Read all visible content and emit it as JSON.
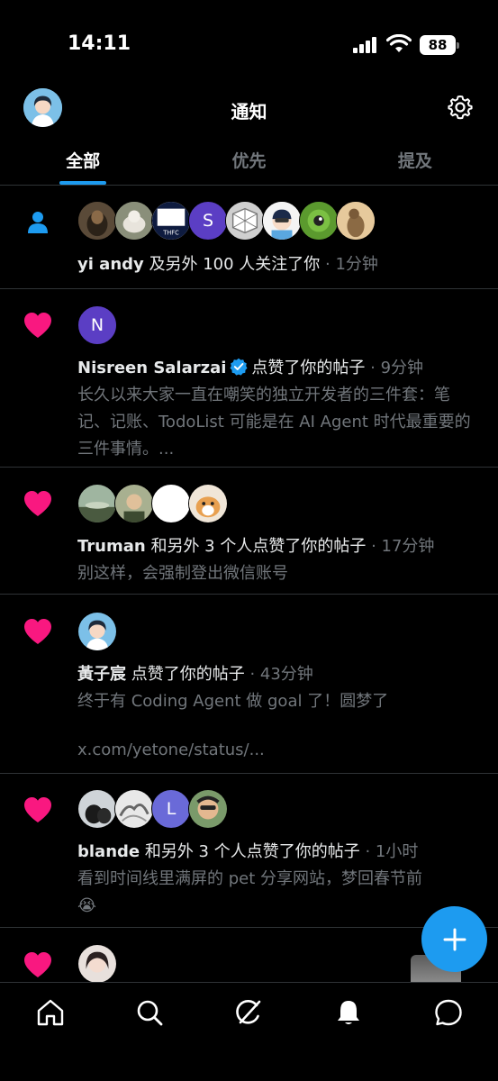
{
  "status_bar": {
    "time": "14:11",
    "battery": "88"
  },
  "header": {
    "title": "通知"
  },
  "tabs": [
    {
      "label": "全部"
    },
    {
      "label": "优先"
    },
    {
      "label": "提及"
    }
  ],
  "notifications": [
    {
      "type": "follow",
      "name": "yi andy",
      "action": " 及另外 100 人关注了你",
      "time": " · 1分钟",
      "avatar_letters": [
        "S"
      ]
    },
    {
      "type": "like",
      "name": "Nisreen Salarzai",
      "verified": true,
      "action": "点赞了你的帖子",
      "time": " · 9分钟",
      "avatar_letters": [
        "N"
      ],
      "body": "长久以来大家一直在嘲笑的独立开发者的三件套：笔记、记账、TodoList 可能是在 AI Agent 时代最重要的三件事情。..."
    },
    {
      "type": "like",
      "name": "Truman",
      "action": " 和另外 3 个人点赞了你的帖子",
      "time": " · 17分钟",
      "body": "别这样，会强制登出微信账号"
    },
    {
      "type": "like",
      "name": "黃子宸",
      "action": " 点赞了你的帖子",
      "time": " · 43分钟",
      "body": "终于有 Coding Agent 做 goal 了！圆梦了",
      "link": "x.com/yetone/status/..."
    },
    {
      "type": "like",
      "name": "blande",
      "action": " 和另外 3 个人点赞了你的帖子",
      "time": " · 1小时",
      "avatar_letters": [
        "L"
      ],
      "body": "看到时间线里满屏的 pet 分享网站，梦回春节前",
      "emoji": "😭"
    },
    {
      "type": "like"
    }
  ],
  "icons": {
    "settings": "gear-icon",
    "follow": "person-icon",
    "like": "heart-icon",
    "fab": "plus-icon",
    "nav": [
      "home-icon",
      "search-icon",
      "grok-icon",
      "bell-icon",
      "messages-icon"
    ]
  },
  "colors": {
    "accent": "#1d9bf0",
    "like": "#f91880",
    "muted": "#71767b",
    "background": "#000000"
  }
}
